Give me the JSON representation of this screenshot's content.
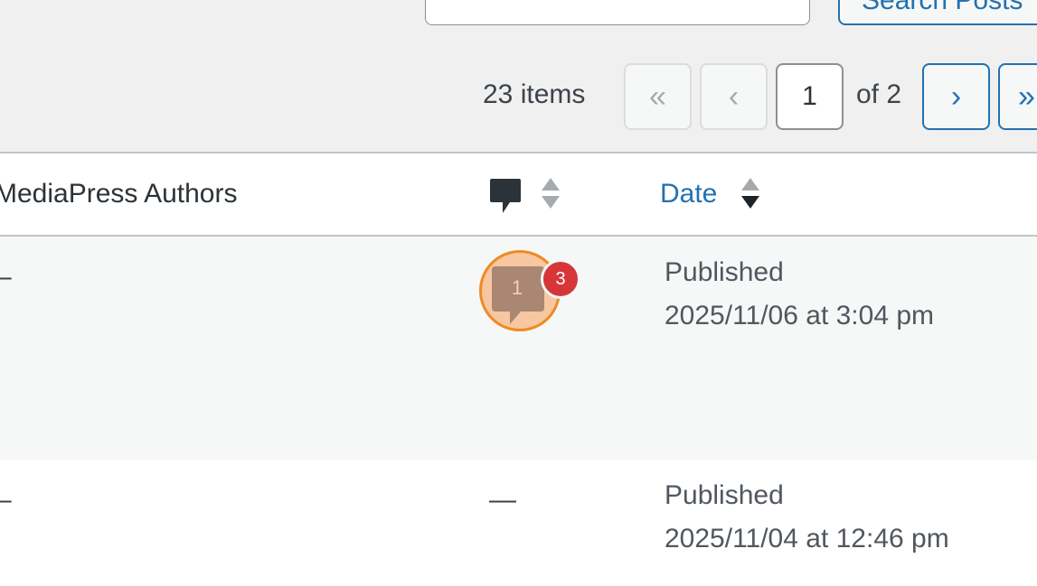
{
  "search": {
    "button_label": "Search Posts"
  },
  "pagination": {
    "items_count": "23 items",
    "first_label": "«",
    "prev_label": "‹",
    "current_page": "1",
    "of_text": "of 2",
    "next_label": "›",
    "last_label": "»"
  },
  "table": {
    "columns": {
      "authors": "MediaPress Authors",
      "comments_icon": "comment-icon",
      "date": "Date"
    },
    "rows": [
      {
        "authors": "–",
        "comments_approved": "1",
        "comments_pending": "3",
        "date_status": "Published",
        "date_value": "2025/11/06 at 3:04 pm"
      },
      {
        "authors": "–",
        "comments": "—",
        "date_status": "Published",
        "date_value": "2025/11/04 at 12:46 pm"
      }
    ]
  },
  "colors": {
    "link": "#2271b1",
    "pending_badge": "#d63638",
    "highlight": "#f08a24"
  }
}
